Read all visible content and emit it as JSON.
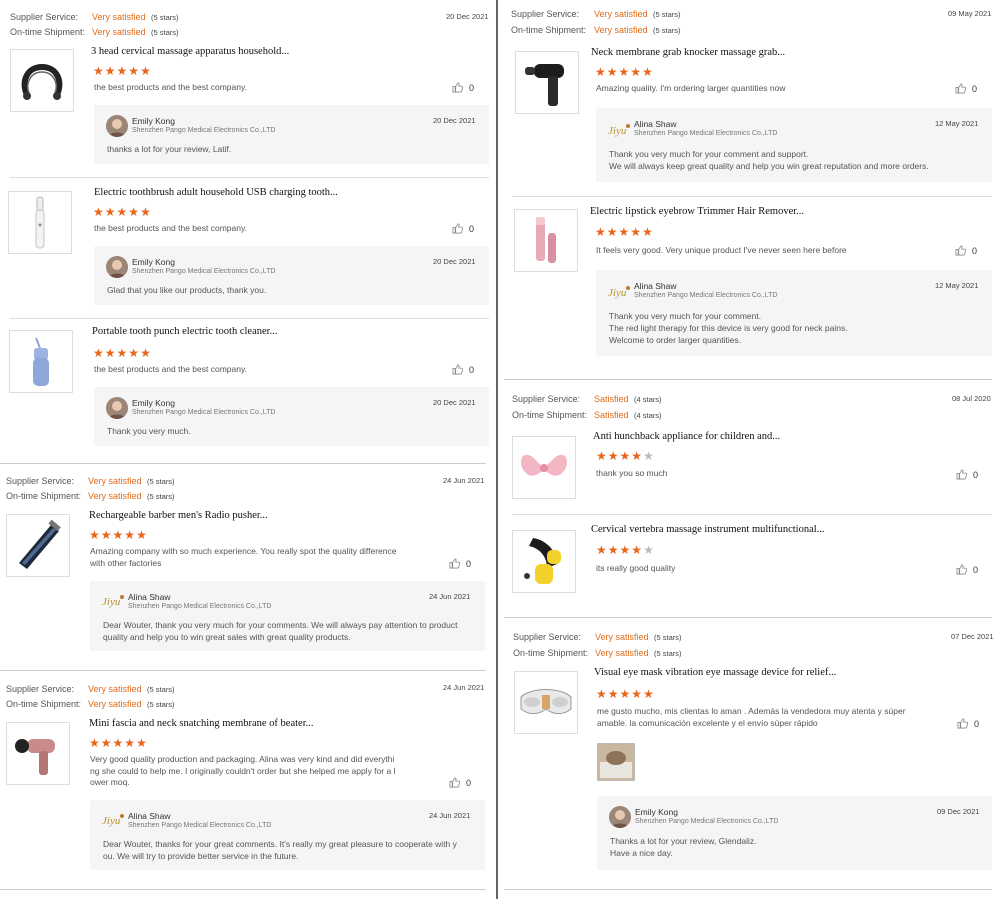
{
  "left": {
    "block1": {
      "supplier_label": "Supplier Service:",
      "supplier_value": "Very satisfied",
      "supplier_stars": "(5 stars)",
      "shipment_label": "On-time Shipment:",
      "shipment_value": "Very satisfied",
      "shipment_stars": "(5 stars)",
      "date": "20 Dec 2021",
      "items": [
        {
          "title": "3 head cervical massage apparatus household...",
          "stars": 5,
          "text": "the best products and the best company.",
          "likes": "0",
          "reply": {
            "name": "Emily Kong",
            "company": "Shenzhen Pango Medical Electronics Co.,LTD",
            "date": "20 Dec 2021",
            "text": "thanks a lot for your review, Latif."
          }
        },
        {
          "title": "Electric toothbrush adult household USB charging tooth...",
          "stars": 5,
          "text": "the best products and the best company.",
          "likes": "0",
          "reply": {
            "name": "Emily Kong",
            "company": "Shenzhen Pango Medical Electronics Co.,LTD",
            "date": "20 Dec 2021",
            "text": "Glad that you like our products, thank you."
          }
        },
        {
          "title": "Portable tooth punch electric tooth cleaner...",
          "stars": 5,
          "text": "the best products and the best company.",
          "likes": "0",
          "reply": {
            "name": "Emily Kong",
            "company": "Shenzhen Pango Medical Electronics Co.,LTD",
            "date": "20 Dec 2021",
            "text": "Thank you very much."
          }
        }
      ]
    },
    "block2": {
      "supplier_label": "Supplier Service:",
      "supplier_value": "Very satisfied",
      "supplier_stars": "(5 stars)",
      "shipment_label": "On-time Shipment:",
      "shipment_value": "Very satisfied",
      "shipment_stars": "(5 stars)",
      "date": "24 Jun 2021",
      "item": {
        "title": "Rechargeable barber men's Radio pusher...",
        "stars": 5,
        "text1": "Amazing company with so much experience. You really spot the quality difference",
        "text2": "with other factories",
        "likes": "0",
        "reply": {
          "name": "Alina Shaw",
          "company": "Shenzhen Pango Medical Electronics Co.,LTD",
          "date": "24 Jun 2021",
          "text1": "Dear Wouter, thank you very much for your comments. We will always pay attention to product",
          "text2": "quality and help you to win great sales with great quality products."
        }
      }
    },
    "block3": {
      "supplier_label": "Supplier Service:",
      "supplier_value": "Very satisfied",
      "supplier_stars": "(5 stars)",
      "shipment_label": "On-time Shipment:",
      "shipment_value": "Very satisfied",
      "shipment_stars": "(5 stars)",
      "date": "24 Jun 2021",
      "item": {
        "title": "Mini fascia and neck snatching membrane of beater...",
        "stars": 5,
        "text1": "Very good quality production and packaging. Alina was very kind and did everythi",
        "text2": "ng she could to help me. I originally couldn't order but she helped me apply for a l",
        "text3": "ower moq.",
        "likes": "0",
        "reply": {
          "name": "Alina Shaw",
          "company": "Shenzhen Pango Medical Electronics Co.,LTD",
          "date": "24 Jun 2021",
          "text1": "Dear Wouter, thanks for your great comments. It's really my great pleasure to cooperate with y",
          "text2": "ou. We will try to provide  better service in the future."
        }
      }
    }
  },
  "right": {
    "block1": {
      "supplier_label": "Supplier Service:",
      "supplier_value": "Very satisfied",
      "supplier_stars": "(5 stars)",
      "shipment_label": "On-time Shipment:",
      "shipment_value": "Very satisfied",
      "shipment_stars": "(5 stars)",
      "date": "09 May 2021",
      "item1": {
        "title": "Neck membrane grab knocker massage grab...",
        "stars": 5,
        "text": "Amazing quality. I'm ordering larger quantities now",
        "likes": "0",
        "reply": {
          "name": "Alina Shaw",
          "company": "Shenzhen Pango Medical Electronics Co.,LTD",
          "date": "12 May 2021",
          "text1": "Thank you very much for your comment and support.",
          "text2": "We will always keep great quality and help you win great reputation and more orders."
        }
      },
      "item2": {
        "title": "Electric lipstick eyebrow Trimmer Hair Remover...",
        "stars": 5,
        "text": "It feels very good. Very unique product I've never seen here before",
        "likes": "0",
        "reply": {
          "name": "Alina Shaw",
          "company": "Shenzhen Pango Medical Electronics Co.,LTD",
          "date": "12 May 2021",
          "text1": "Thank you very much for your comment.",
          "text2": "The red light therapy for this device is very good for neck pains.",
          "text3": "Welcome to order larger quantities."
        }
      }
    },
    "block2": {
      "supplier_label": "Supplier Service:",
      "supplier_value": "Satisfied",
      "supplier_stars": "(4 stars)",
      "shipment_label": "On-time Shipment:",
      "shipment_value": "Satisfied",
      "shipment_stars": "(4 stars)",
      "date": "08 Jul 2020",
      "item1": {
        "title": "Anti hunchback appliance for children and...",
        "stars": 4,
        "text": "thank you so much",
        "likes": "0"
      },
      "item2": {
        "title": "Cervical vertebra massage instrument multifunctional...",
        "stars": 4,
        "text": "its really good quality",
        "likes": "0"
      }
    },
    "block3": {
      "supplier_label": "Supplier Service:",
      "supplier_value": "Very satisfied",
      "supplier_stars": "(5 stars)",
      "shipment_label": "On-time Shipment:",
      "shipment_value": "Very satisfied",
      "shipment_stars": "(5 stars)",
      "date": "07 Dec 2021",
      "item": {
        "title": "Visual eye mask vibration eye massage device for relief...",
        "stars": 5,
        "text1": "me gusto mucho, mis clientas lo aman . Además la vendedora muy atenta y súper",
        "text2": "amable. la comunicación excelente y el envío súper rápido",
        "likes": "0",
        "reply": {
          "name": "Emily Kong",
          "company": "Shenzhen Pango Medical Electronics Co.,LTD",
          "date": "09 Dec 2021",
          "text1": "Thanks a lot for your review, Glendaliz.",
          "text2": "Have a nice day."
        }
      }
    }
  },
  "colors": {
    "accent": "#e06b1a",
    "star": "#e8651b",
    "reply_bg": "#f5f5f5"
  },
  "icons": [
    "thumbs-up-icon",
    "star-icon",
    "avatar-icon",
    "company-logo-icon"
  ]
}
